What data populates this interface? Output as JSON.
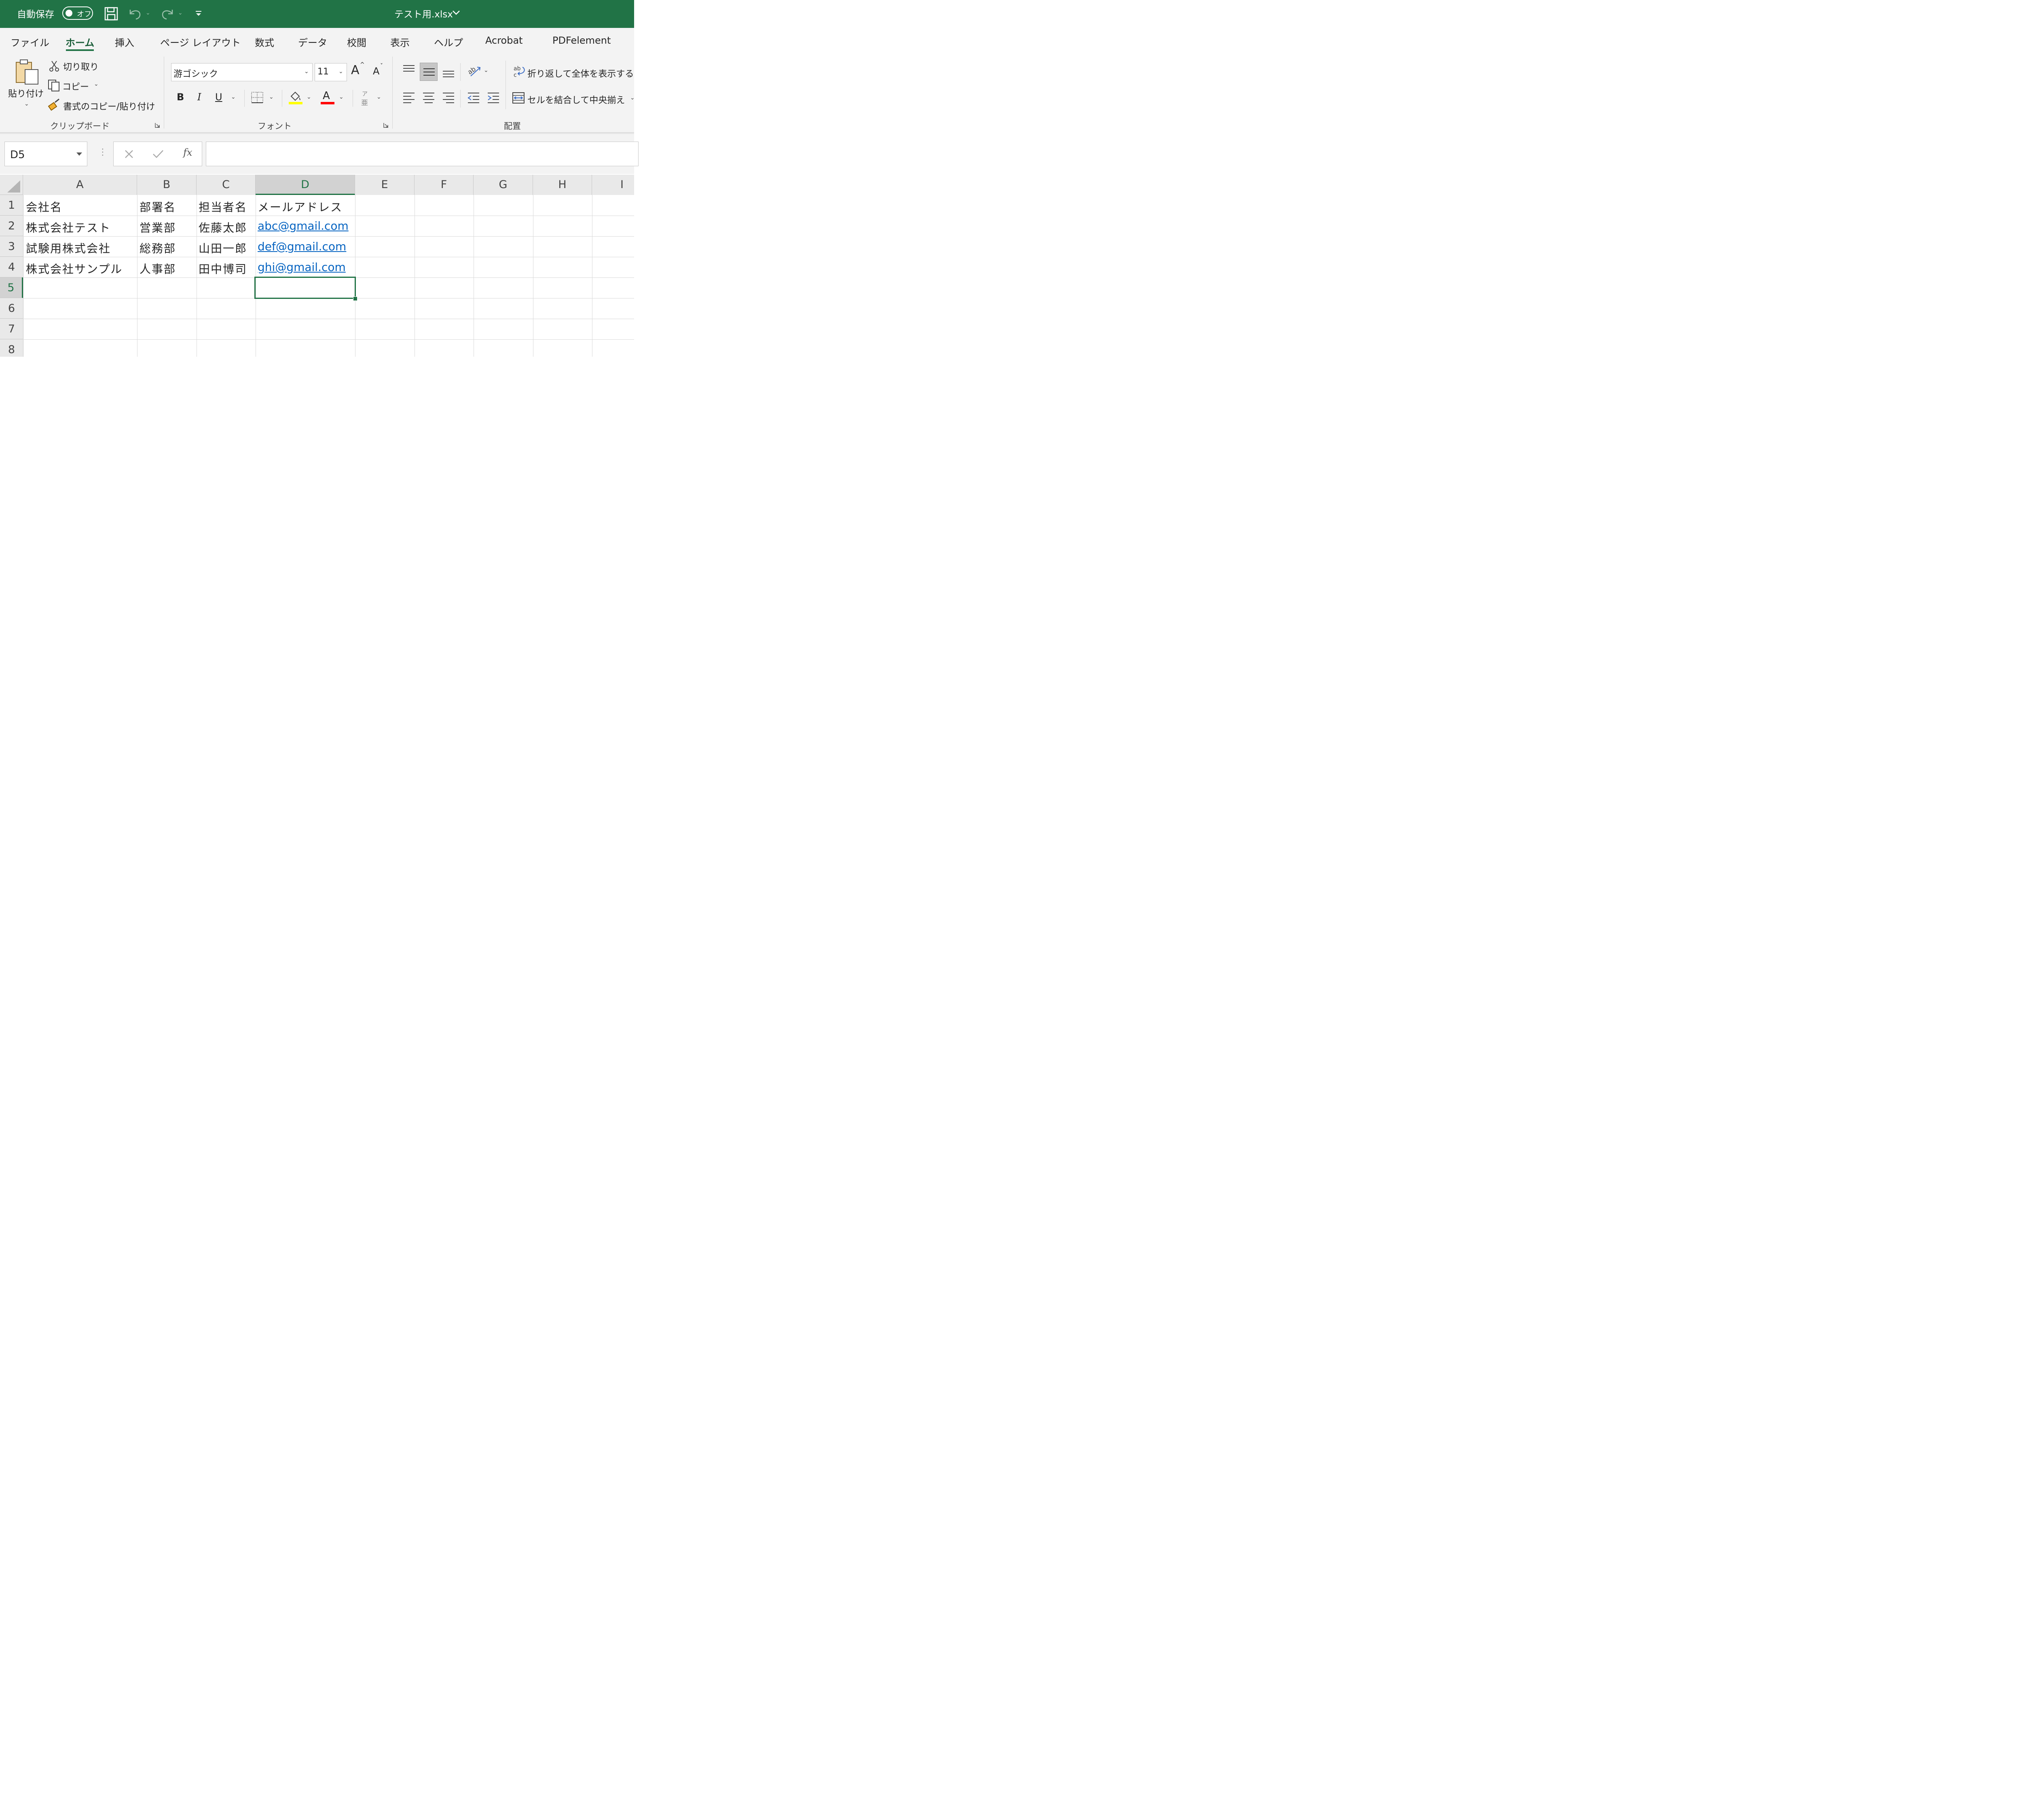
{
  "titlebar": {
    "autosave_label": "自動保存",
    "autosave_state": "オフ",
    "file_title": "テスト用.xlsx",
    "color": "#217346"
  },
  "tabs": [
    "ファイル",
    "ホーム",
    "挿入",
    "ページ レイアウト",
    "数式",
    "データ",
    "校閲",
    "表示",
    "ヘルプ",
    "Acrobat",
    "PDFelement"
  ],
  "active_tab": "ホーム",
  "clipboard": {
    "paste": "貼り付け",
    "cut": "切り取り",
    "copy": "コピー",
    "format_painter": "書式のコピー/貼り付け",
    "label": "クリップボード"
  },
  "font": {
    "name": "游ゴシック",
    "size": "11",
    "grow": "A",
    "shrink": "A",
    "bold": "B",
    "italic": "I",
    "underline": "U",
    "font_color_glyph": "A",
    "furigana_top": "ア",
    "furigana_bottom": "亜",
    "label": "フォント",
    "fill_color": "#ffff00",
    "font_color": "#ff0000"
  },
  "alignment": {
    "wrap_text": "折り返して全体を表示する",
    "merge_center": "セルを結合して中央揃え",
    "label": "配置"
  },
  "formula_bar": {
    "name_box": "D5",
    "fx": "fx",
    "formula": ""
  },
  "grid": {
    "columns": [
      "A",
      "B",
      "C",
      "D",
      "E",
      "F",
      "G",
      "H",
      "I"
    ],
    "rows": [
      "1",
      "2",
      "3",
      "4",
      "5",
      "6",
      "7",
      "8"
    ],
    "selected_column": "D",
    "selected_row": "5",
    "link_color": "#0563c1",
    "data": [
      [
        "会社名",
        "部署名",
        "担当者名",
        "メールアドレス"
      ],
      [
        "株式会社テスト",
        "営業部",
        "佐藤太郎",
        "abc@gmail.com"
      ],
      [
        "試験用株式会社",
        "総務部",
        "山田一郎",
        "def@gmail.com"
      ],
      [
        "株式会社サンプル",
        "人事部",
        "田中博司",
        "ghi@gmail.com"
      ]
    ]
  }
}
